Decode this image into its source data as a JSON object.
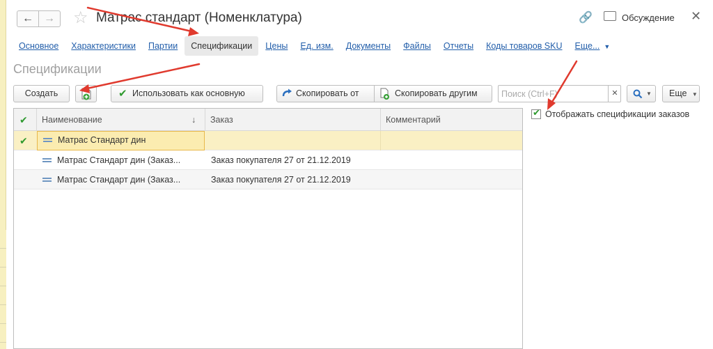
{
  "window": {
    "title": "Матрас стандарт (Номенклатура)",
    "discuss_label": "Обсуждение"
  },
  "tabs": [
    {
      "label": "Основное",
      "active": false
    },
    {
      "label": "Характеристики",
      "active": false
    },
    {
      "label": "Партии",
      "active": false
    },
    {
      "label": "Спецификации",
      "active": true
    },
    {
      "label": "Цены",
      "active": false
    },
    {
      "label": "Ед. изм.",
      "active": false
    },
    {
      "label": "Документы",
      "active": false
    },
    {
      "label": "Файлы",
      "active": false
    },
    {
      "label": "Отчеты",
      "active": false
    },
    {
      "label": "Коды товаров SKU",
      "active": false
    },
    {
      "label": "Еще...",
      "active": false
    }
  ],
  "section_title": "Спецификации",
  "toolbar": {
    "create_label": "Создать",
    "use_as_main_label": "Использовать как основную",
    "copy_from_label": "Скопировать от",
    "copy_to_others_label": "Скопировать другим",
    "search_placeholder": "Поиск (Ctrl+F)",
    "more_label": "Еще"
  },
  "table": {
    "columns": [
      "Наименование",
      "Заказ",
      "Комментарий"
    ],
    "rows": [
      {
        "main": true,
        "name": "Матрас Стандарт дин",
        "order": "",
        "comment": ""
      },
      {
        "main": false,
        "name": "Матрас Стандарт дин (Заказ...",
        "order": "Заказ покупателя 27 от 21.12.2019",
        "comment": ""
      },
      {
        "main": false,
        "name": "Матрас Стандарт дин (Заказ...",
        "order": "Заказ покупателя 27 от 21.12.2019",
        "comment": ""
      }
    ]
  },
  "option": {
    "label": "Отображать спецификации заказов",
    "checked": true
  },
  "colors": {
    "accent_link": "#225eaa",
    "selection": "#faf0c4",
    "check_green": "#2f9a2f",
    "annotation_arrow": "#e03a2e"
  }
}
